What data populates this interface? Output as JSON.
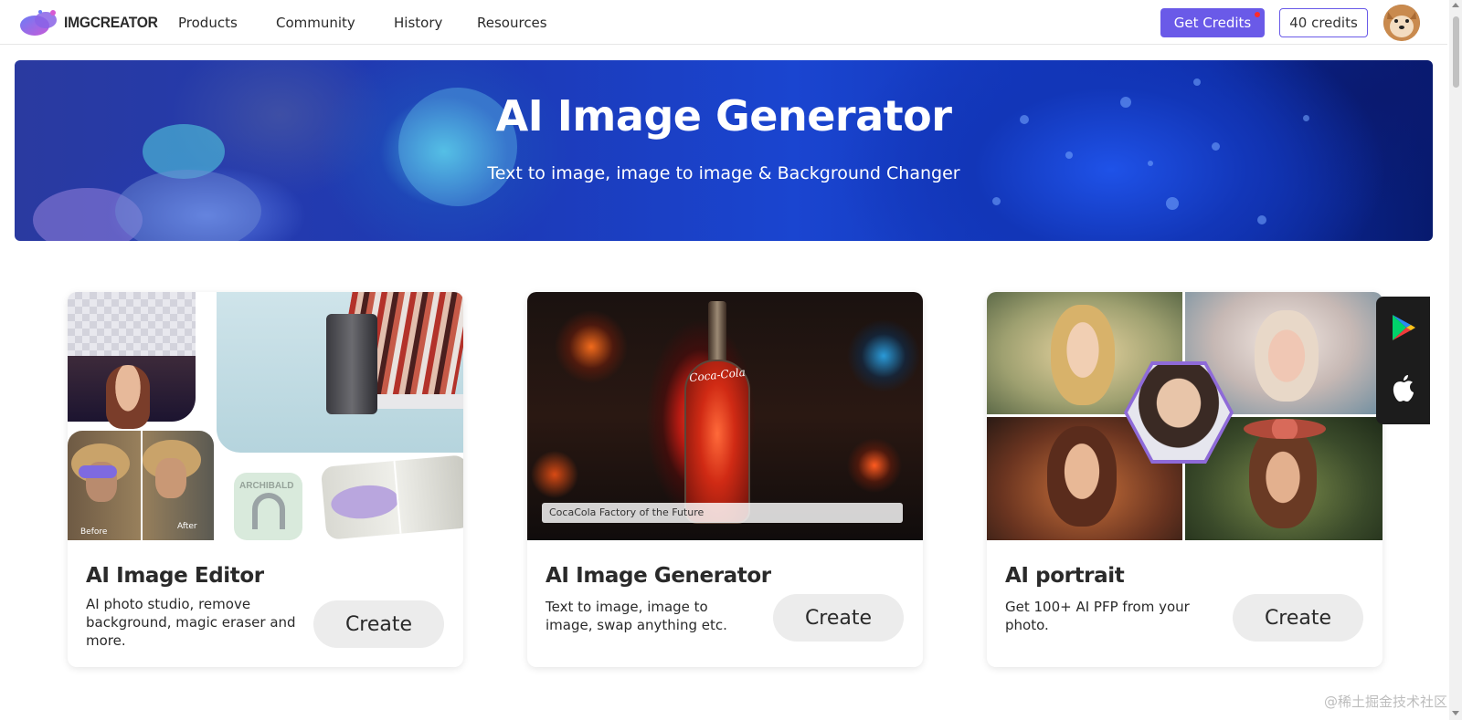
{
  "nav": {
    "brand": "IMGCREATOR",
    "links": [
      "Products",
      "Community",
      "History",
      "Resources"
    ],
    "get_credits_label": "Get Credits",
    "credits_label": "40 credits"
  },
  "hero": {
    "title": "AI Image Generator",
    "subtitle": "Text to image, image to image & Background Changer"
  },
  "cards": [
    {
      "title": "AI Image Editor",
      "description": "AI photo studio, remove background, magic eraser and more.",
      "button": "Create",
      "labels": {
        "before": "Before",
        "after": "After",
        "product": "ARCHIBALD"
      }
    },
    {
      "title": "AI Image Generator",
      "description": "Text to image, image to image, swap anything etc.",
      "button": "Create",
      "caption": "CocaCola Factory of the Future",
      "bottle_logo": "Coca-Cola"
    },
    {
      "title": "AI portrait",
      "description": "Get 100+ AI PFP from your photo.",
      "button": "Create"
    }
  ],
  "app_panel": {
    "icons": [
      "google-play-icon",
      "apple-icon"
    ]
  },
  "watermark": "@稀土掘金技术社区",
  "colors": {
    "accent": "#6a5ae8",
    "notification": "#ff2b2b",
    "button_bg": "#ececec"
  }
}
